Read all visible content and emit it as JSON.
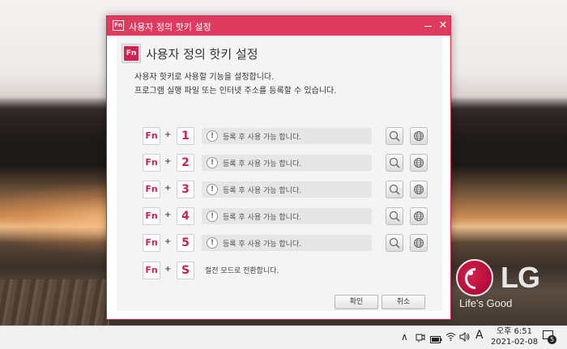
{
  "window": {
    "title_icon": "Fn",
    "title": "사용자 정의 핫키 설정",
    "minimize_icon": "minimize-icon",
    "close_glyph": "✕"
  },
  "header": {
    "icon": "Fn",
    "title": "사용자 정의 핫키 설정",
    "desc1": "사용자 핫키로 사용할 기능을 설정합니다.",
    "desc2": "프로그램 실행 파일 또는 인터넷 주소를 등록할 수 있습니다."
  },
  "hotkeys": [
    {
      "fn": "Fn",
      "plus": "+",
      "key": "1",
      "warn": "!",
      "text": "등록 후 사용 가능 합니다."
    },
    {
      "fn": "Fn",
      "plus": "+",
      "key": "2",
      "warn": "!",
      "text": "등록 후 사용 가능 합니다."
    },
    {
      "fn": "Fn",
      "plus": "+",
      "key": "3",
      "warn": "!",
      "text": "등록 후 사용 가능 합니다."
    },
    {
      "fn": "Fn",
      "plus": "+",
      "key": "4",
      "warn": "!",
      "text": "등록 후 사용 가능 합니다."
    },
    {
      "fn": "Fn",
      "plus": "+",
      "key": "5",
      "warn": "!",
      "text": "등록 후 사용 가능 합니다."
    }
  ],
  "s_row": {
    "fn": "Fn",
    "plus": "+",
    "key": "S",
    "text": "절전 모드로 전환합니다."
  },
  "buttons": {
    "ok": "확인",
    "cancel": "취소"
  },
  "brand": {
    "logo": "LG",
    "slogan": "Life's Good"
  },
  "taskbar": {
    "up_glyph": "∧",
    "ime": "A",
    "time": "오후 6:51",
    "date": "2021-02-08",
    "notification_count": "5"
  },
  "colors": {
    "accent": "#e03a5f",
    "key_red": "#d01f4f"
  }
}
